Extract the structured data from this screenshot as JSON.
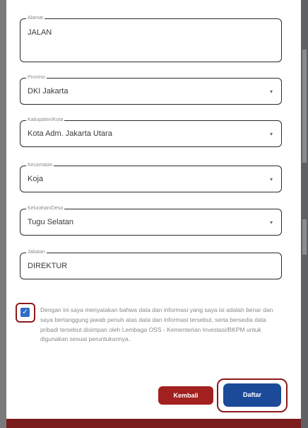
{
  "form": {
    "alamat": {
      "label": "Alamat",
      "value": "JALAN"
    },
    "provinsi": {
      "label": "Provinsi",
      "value": "DKI Jakarta"
    },
    "kabupaten": {
      "label": "Kabupaten/Kota",
      "value": "Kota Adm. Jakarta Utara"
    },
    "kecamatan": {
      "label": "Kecamatan",
      "value": "Koja"
    },
    "kelurahan": {
      "label": "Kelurahan/Desa",
      "value": "Tugu Selatan"
    },
    "jabatan": {
      "label": "Jabatan",
      "value": "DIREKTUR"
    }
  },
  "consent": {
    "checked": true,
    "text": "Dengan ini saya menyatakan bahwa data dan informasi yang saya isi adalah benar dan saya bertanggung jawab penuh atas data dan informasi tersebut, serta bersedia data pribadi tersebut disimpan oleh Lembaga OSS - Kementerian Investasi/BKPM untuk digunakan sesuai peruntukannya."
  },
  "buttons": {
    "back_label": "Kembali",
    "submit_label": "Daftar"
  },
  "icons": {
    "dropdown": "chevron-down-icon",
    "checkbox": "checkmark-icon"
  },
  "colors": {
    "back_button": "#a2201f",
    "submit_button": "#1b4b98",
    "highlight": "#8b1a1a",
    "checkbox": "#2f6dc9"
  }
}
